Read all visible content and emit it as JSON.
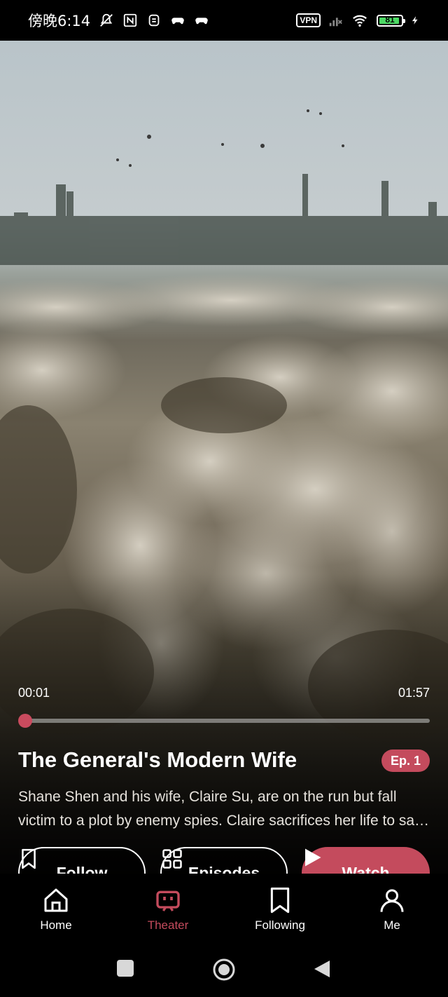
{
  "status_bar": {
    "time": "傍晚6:14",
    "vpn_label": "VPN",
    "battery": "81",
    "icons": [
      "mute-icon",
      "nfc-icon",
      "app-icon",
      "gamepad-icon",
      "gamepad-icon",
      "signal-icon",
      "wifi-icon",
      "charging-icon"
    ]
  },
  "player": {
    "current_time": "00:01",
    "total_time": "01:57",
    "progress_fraction": 0.01
  },
  "show": {
    "title": "The General's Modern Wife",
    "episode_badge": "Ep. 1",
    "description": "Shane Shen and his wife, Claire Su, are on the run but fall victim to a plot by enemy spies. Claire sacrifices her life to save Shane, but she suddenly wakes up in modern times."
  },
  "actions": {
    "follow_label": "Follow",
    "episodes_label": "Episodes",
    "watch_label": "Watch"
  },
  "nav": {
    "items": [
      {
        "label": "Home",
        "icon": "home-icon"
      },
      {
        "label": "Theater",
        "icon": "theater-icon",
        "active": true
      },
      {
        "label": "Following",
        "icon": "bookmark-icon"
      },
      {
        "label": "Me",
        "icon": "person-icon"
      }
    ]
  },
  "colors": {
    "accent": "#c44b5d",
    "background": "#000000"
  }
}
